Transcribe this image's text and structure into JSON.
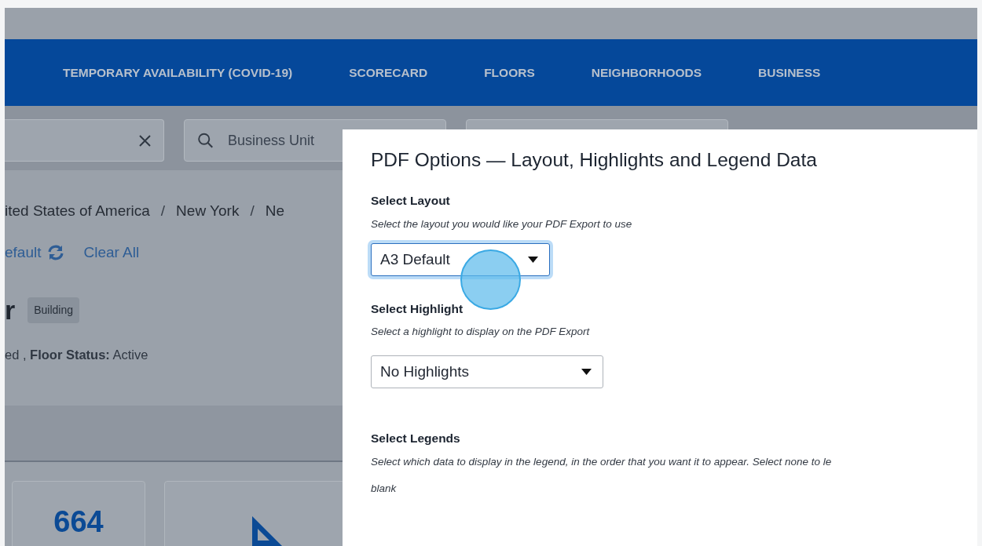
{
  "nav": {
    "items": [
      "TEMPORARY AVAILABILITY (COVID-19)",
      "SCORECARD",
      "FLOORS",
      "NEIGHBORHOODS",
      "BUSINESS"
    ]
  },
  "filters": [
    {
      "kind": "clearable"
    },
    {
      "kind": "search",
      "placeholder": "Business Unit"
    },
    {
      "kind": "blank"
    }
  ],
  "breadcrumb": [
    {
      "kind": "link",
      "text": "ited States of America"
    },
    {
      "kind": "separator",
      "text": "/"
    },
    {
      "kind": "link",
      "text": "New York"
    },
    {
      "kind": "separator",
      "text": "/"
    },
    {
      "kind": "link",
      "text": "Ne"
    }
  ],
  "actions": [
    {
      "kind": "reset",
      "label": "efault"
    },
    {
      "kind": "link",
      "label": "Clear All"
    }
  ],
  "heading": {
    "text": "r",
    "badge": "Building"
  },
  "status": "ed , **Floor Status:** Active",
  "cards": [
    {
      "kind": "number",
      "value": "664"
    },
    {
      "kind": "icon"
    }
  ],
  "modal": {
    "title": "PDF Options — Layout, Highlights and Legend Data",
    "sections": [
      {
        "label": "Select Layout",
        "hint": "Select the layout you would like your PDF Export to use",
        "select": {
          "value": "A3 Default",
          "focused": true
        }
      },
      {
        "label": "Select Highlight",
        "hint": "Select a highlight to display on the PDF Export",
        "select": {
          "value": "No Highlights",
          "focused": false
        }
      },
      {
        "label": "Select Legends",
        "hint": "Select which data to display in the legend, in the order that you want it to appear. Select none to le",
        "hint_continued": "blank"
      }
    ]
  }
}
